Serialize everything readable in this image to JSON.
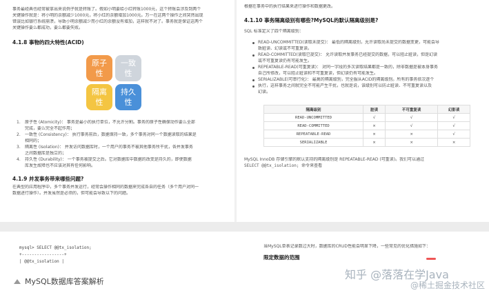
{
  "left_page": {
    "intro_lines": [
      "事务最经典也经常被拿出来说例子就是转账了。假如小明要给小红转账1000元，这个转账会涉及到两个",
      "关键操作就是：将小明的余额减少1000元，将小红的余额增加1000元。万一在这两个操作之间突然出现",
      "错误比如银行系统崩溃，导致小明余额减少而小红的余额没有增加，这样就不对了。事务就是保证这两个",
      "关键操作要么都成功，要么都要失败。"
    ],
    "section_heading": "4.1.8 事物的四大特性(ACID)",
    "acid": [
      {
        "label": "原子\n性",
        "color": "#f29a4a"
      },
      {
        "label": "一致\n性",
        "color": "#cfd5dc"
      },
      {
        "label": "隔离\n性",
        "color": "#f4c542"
      },
      {
        "label": "持久\n性",
        "color": "#4a90d9"
      }
    ],
    "acid_list": [
      {
        "num": "1.",
        "text": "原子性 (Atomicity)： 事务是最小的执行单位，不允许分割。事务的原子性确保动作要么全部"
      },
      {
        "num": "",
        "text": "完成，要么完全不起作用；"
      },
      {
        "num": "2.",
        "text": "一致性 (Consistency)： 执行事务前后，数据保持一致，多个事务对同一个数据读取的结果是"
      },
      {
        "num": "",
        "text": "相同的；"
      },
      {
        "num": "3.",
        "text": "隔离性 (Isolation)： 并发访问数据库时，一个用户的事务不被其他事务所干扰，各并发事务"
      },
      {
        "num": "",
        "text": "之间数据库是独立的；"
      },
      {
        "num": "4.",
        "text": "持久性 (Durability)： 一个事务被提交之后。它对数据库中数据的改变是持久的，即使数据"
      },
      {
        "num": "",
        "text": "库发生故障也不应该对其有任何影响。"
      }
    ],
    "section_heading_2": "4.1.9 并发事务带来哪些问题?",
    "concurrency_lines": [
      "在典型的应用程序中，多个事务并发运行，经常会操作相同的数据来完成各自的任务（多个用户对同一",
      "数据进行操作）。并发虽然是必须的，但可能会导致以下的问题。"
    ]
  },
  "right_page": {
    "top_line": "根据在事务中的执行结果来进行操作和数据更改。",
    "section_heading": "4.1.10 事务隔离级别有哪些?MySQL的默认隔离级别是?",
    "intro": "SQL 标准定义了四个隔离级别：",
    "levels": [
      {
        "text": "READ-UNCOMMITTED(读取未提交)： 最低的隔离级别，允许读取尚未提交的数据变更，可能会导"
      },
      {
        "text": "致脏读、幻读或不可重复读。",
        "cont": true
      },
      {
        "text": "READ-COMMITTED(读取已提交)： 允许读取并发事务已经提交的数据，可以阻止脏读，但是幻读"
      },
      {
        "text": "或不可重复读仍有可能发生。",
        "cont": true
      },
      {
        "text": "REPEATABLE-READ(可重复读)： 对同一字段的多次读取结果都是一致的，除非数据是被本身事务"
      },
      {
        "text": "自己所修改，可以阻止脏读和不可重复读，但幻读仍有可能发生。",
        "cont": true
      },
      {
        "text": "SERIALIZABLE(可串行化)： 最高的隔离级别，完全服从ACID的隔离级别。所有的事务依次逐个"
      },
      {
        "text": "执行，这样事务之间就完全不可能产生干扰，也就是说，该级别可以防止脏读、不可重复读以及"
      },
      {
        "text": "幻读。",
        "cont": true
      }
    ],
    "table": {
      "headers": [
        "隔离级别",
        "脏读",
        "不可重复读",
        "幻影读"
      ],
      "rows": [
        [
          "READ-UNCOMMITTED",
          "√",
          "√",
          "√"
        ],
        [
          "READ-COMMITTED",
          "×",
          "√",
          "√"
        ],
        [
          "REPEATABLE-READ",
          "×",
          "×",
          "√"
        ],
        [
          "SERIALIZABLE",
          "×",
          "×",
          "×"
        ]
      ]
    },
    "after_table_1": "MySQL InnoDB 存储引擎的默认支持的隔离级别是 REPEATABLE-READ (可重读)。我们可以通过",
    "after_table_2": "SELECT @@tx_isolation; 命令来查看"
  },
  "bottom_left": {
    "code_lines": [
      "mysql> SELECT @@tx_isolation;",
      "+-----------------+",
      "| @@tx_isolation  |"
    ]
  },
  "bottom_right": {
    "line1": "当MySQL单表记录数过大时，数据库的CRUD性能会明显下降，一些常见的优化措施如下：",
    "heading": "限定数据的范围"
  },
  "caption": "MySQL数据库答案解析",
  "watermark": {
    "line1": "知乎 @落落在学Java",
    "line2": "@稀土掘金技术社区"
  }
}
